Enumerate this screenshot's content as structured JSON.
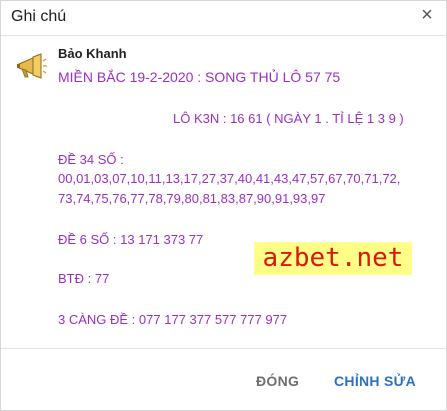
{
  "dialog": {
    "title": "Ghi chú",
    "close_glyph": "×"
  },
  "author": {
    "name": "Bảo Khanh",
    "avatar_icon": "megaphone-icon"
  },
  "lines": {
    "l1": "MIỀN BẮC 19-2-2020 : SONG THỦ LÔ 57 75",
    "l2": "LÔ K3N : 16 61 ( NGÀY 1 . TỈ LỆ 1 3 9 )",
    "l3": "ĐỀ 34 SỐ :",
    "l4": "00,01,03,07,10,11,13,17,27,37,40,41,43,47,57,67,70,71,72,",
    "l5": "73,74,75,76,77,78,79,80,81,83,87,90,91,93,97",
    "l6": "ĐỀ  6 SỐ : 13 171 373 77",
    "l7": "BTĐ : 77",
    "l8": "3 CÀNG ĐỀ : 077 177 377 577 777 977"
  },
  "watermark": "azbet.net",
  "footer": {
    "close_label": "ĐÓNG",
    "edit_label": "CHỈNH SỬA"
  },
  "colors": {
    "note_text": "#9a2fc4",
    "watermark_bg": "#ffff88",
    "watermark_text": "#d8180b",
    "primary_button": "#2d6fc2",
    "secondary_button": "#6e6e6e"
  }
}
